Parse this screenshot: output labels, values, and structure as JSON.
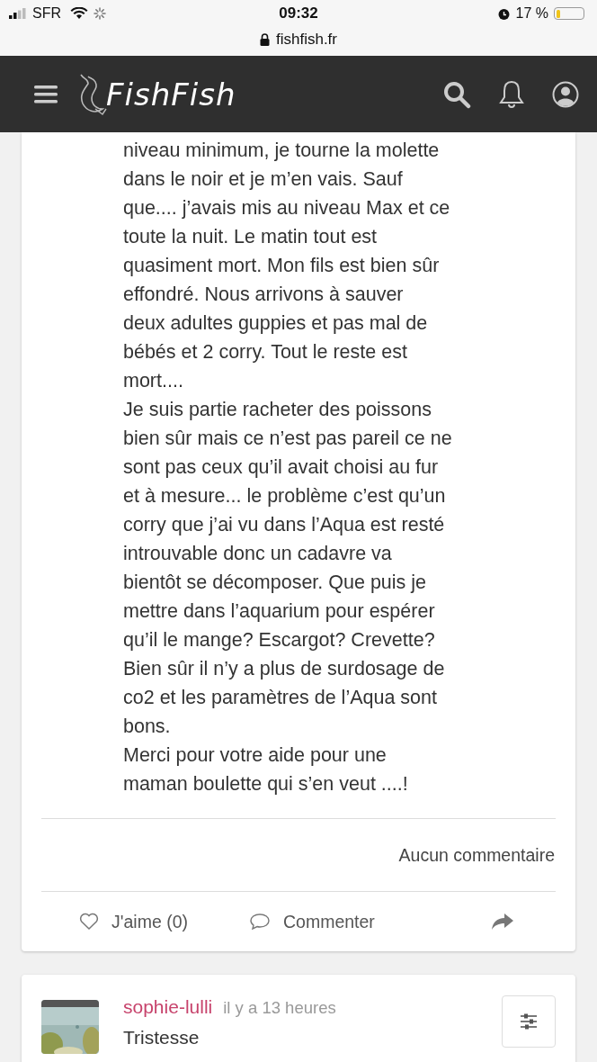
{
  "status_bar": {
    "carrier": "SFR",
    "time": "09:32",
    "battery": "17 %"
  },
  "url_bar": {
    "address": "fishfish.fr"
  },
  "header": {
    "logo": "FishFish"
  },
  "post": {
    "paragraphs": [
      {
        "lines": [
          "niveau minimum, je tourne la molette",
          "dans le noir et je m’en vais. Sauf",
          "que.... j’avais mis au niveau Max et ce",
          "toute la nuit. Le matin tout est",
          "quasiment mort. Mon fils est bien sûr",
          "effondré. Nous arrivons à sauver",
          "deux adultes guppies et pas mal de",
          "bébés et 2 corry. Tout le reste est",
          "mort...."
        ]
      },
      {
        "lines": [
          "Je suis partie racheter des poissons",
          "bien sûr mais ce n’est pas pareil ce ne",
          "sont pas ceux qu’il avait choisi au fur",
          "et à mesure... le problème c’est qu’un",
          "corry que j’ai vu dans l’Aqua est resté",
          "introuvable donc un cadavre va",
          "bientôt se décomposer. Que puis je",
          "mettre dans l’aquarium pour espérer",
          "qu’il le mange? Escargot? Crevette?",
          "Bien sûr il n’y a plus de surdosage de",
          "co2 et les paramètres de l’Aqua sont",
          "bons."
        ]
      },
      {
        "lines": [
          "Merci pour votre aide pour une",
          "maman boulette qui s’en veut ....!"
        ]
      }
    ],
    "comments": "Aucun commentaire",
    "like": "J'aime (0)",
    "comment": "Commenter"
  },
  "next_post": {
    "author": "sophie-lulli",
    "time": "il y a 13 heures",
    "title": "Tristesse"
  }
}
